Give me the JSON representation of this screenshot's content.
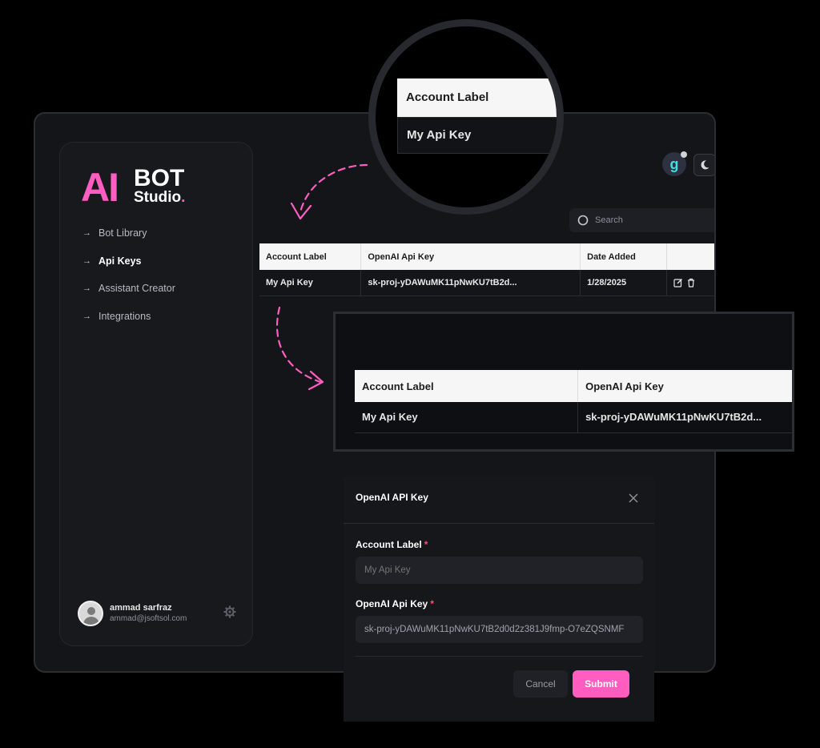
{
  "logo": {
    "ai": "AI",
    "bot": "BOT",
    "studio": "Studio",
    "studio_dot": "."
  },
  "colors": {
    "accent": "#ff5ec0",
    "background": "#141519",
    "header_bg": "#f6f6f6",
    "required": "#ff4f6d"
  },
  "sidebar": {
    "items": [
      {
        "label": "Bot Library",
        "active": false
      },
      {
        "label": "Api Keys",
        "active": true
      },
      {
        "label": "Assistant Creator",
        "active": false
      },
      {
        "label": "Integrations",
        "active": false
      }
    ],
    "user": {
      "name": "ammad sarfraz",
      "email": "ammad@jsoftsol.com"
    }
  },
  "header": {
    "avatar_letter": "g"
  },
  "search": {
    "placeholder": "Search"
  },
  "table": {
    "columns": [
      "Account Label",
      "OpenAI Api Key",
      "Date Added",
      ""
    ],
    "rows": [
      {
        "label": "My Api Key",
        "key": "sk-proj-yDAWuMK11pNwKU7tB2d...",
        "date": "1/28/2025"
      }
    ]
  },
  "magnifier": {
    "header": "Account Label",
    "cell": "My Api Key"
  },
  "zoom": {
    "columns": [
      "Account Label",
      "OpenAI Api Key"
    ],
    "row": {
      "label": "My Api Key",
      "key": "sk-proj-yDAWuMK11pNwKU7tB2d..."
    }
  },
  "modal": {
    "title": "OpenAI API Key",
    "account_label": {
      "label": "Account Label",
      "required_mark": "*",
      "placeholder": "My Api Key"
    },
    "api_key": {
      "label": "OpenAI Api Key",
      "required_mark": "*",
      "value": "sk-proj-yDAWuMK11pNwKU7tB2d0d2z381J9fmp-O7eZQSNMF"
    },
    "cancel": "Cancel",
    "submit": "Submit"
  }
}
